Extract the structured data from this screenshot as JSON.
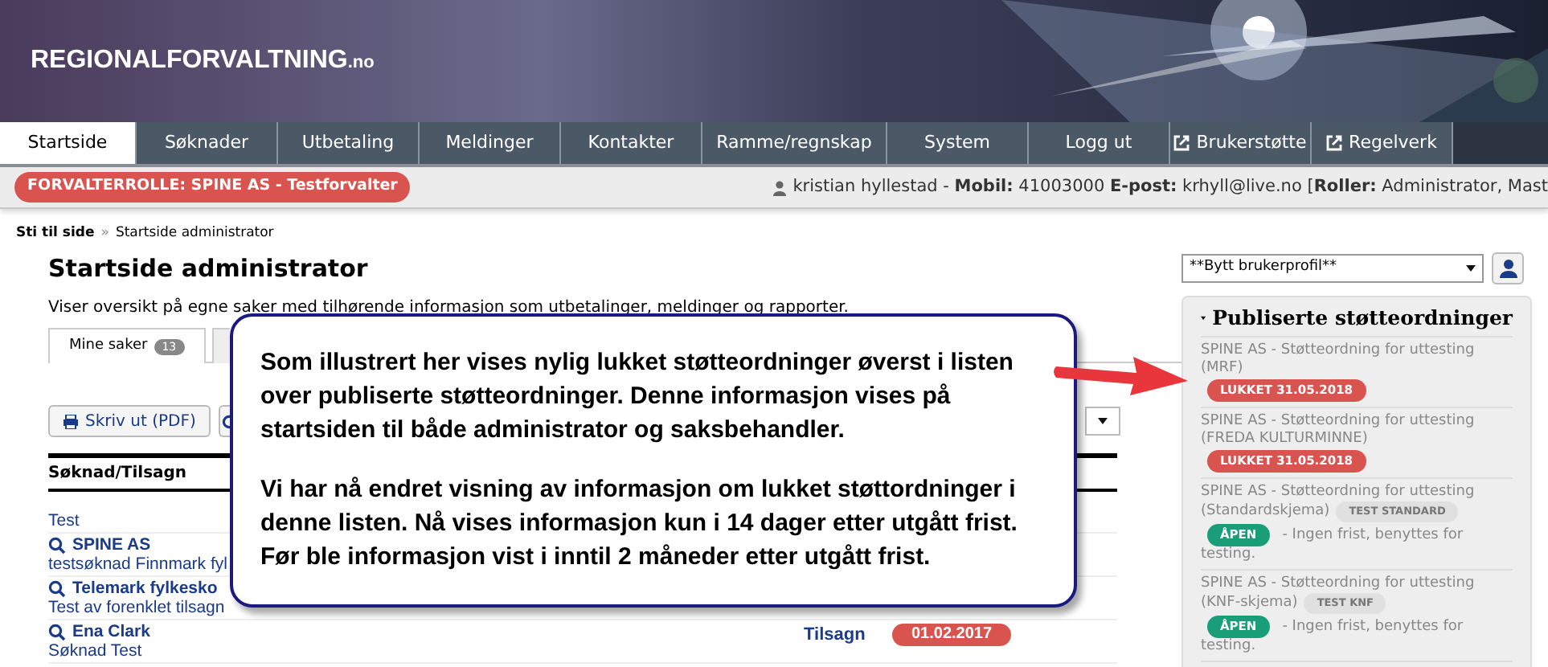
{
  "header": {
    "logo": "REGIONALFORVALTNING",
    "logo_suffix": ".no"
  },
  "nav": [
    {
      "label": "Startside",
      "selected": true,
      "external": false
    },
    {
      "label": "Søknader",
      "selected": false,
      "external": false
    },
    {
      "label": "Utbetaling",
      "selected": false,
      "external": false
    },
    {
      "label": "Meldinger",
      "selected": false,
      "external": false
    },
    {
      "label": "Kontakter",
      "selected": false,
      "external": false
    },
    {
      "label": "Ramme/regnskap",
      "selected": false,
      "external": false
    },
    {
      "label": "System",
      "selected": false,
      "external": false
    },
    {
      "label": "Logg ut",
      "selected": false,
      "external": false
    },
    {
      "label": "Brukerstøtte",
      "selected": false,
      "external": true
    },
    {
      "label": "Regelverk",
      "selected": false,
      "external": true
    }
  ],
  "role_badge": "FORVALTERROLLE: SPINE AS - Testforvalter",
  "user_info": "kristian hyllestad - **Mobil:** 41003000 **E-post:** krhyll@live.no [**Roller:** Administrator, Mast",
  "breadcrumb": {
    "root": "Sti til side",
    "separator": "»",
    "current": "Startside administrator"
  },
  "title": "Startside administrator",
  "description": "Viser oversikt på egne saker med tilhørende informasjon som utbetalinger, meldinger og rapporter.",
  "tabs": [
    {
      "label": "Mine saker",
      "count": "13",
      "selected": true
    }
  ],
  "print_button": "Skriv ut (PDF)",
  "table": {
    "column": "Søknad/Tilsagn",
    "rows": [
      {
        "title": "Test",
        "link": false
      },
      {
        "title": "SPINE AS",
        "subtitle": "testsøknad Finnmark fyl",
        "link": true
      },
      {
        "title": "Telemark fylkesko",
        "subtitle": "Test av forenklet tilsagn",
        "link": true
      },
      {
        "title": "Ena Clark",
        "subtitle": "Søknad Test",
        "link": true,
        "type": "Tilsagn",
        "date": "01.02.2017"
      }
    ]
  },
  "profile_select": {
    "value": "**Bytt brukerprofil**"
  },
  "published": {
    "title": "Publiserte støtteordninger",
    "expanded": true,
    "items": [
      {
        "name": "SPINE AS - Støtteordning for uttesting",
        "variant": "(MRF)",
        "status": "LUKKET 31.05.2018",
        "kind": "closed"
      },
      {
        "name": "SPINE AS - Støtteordning for uttesting",
        "variant": "(FREDA KULTURMINNE)",
        "status": "LUKKET 31.05.2018",
        "kind": "closed"
      },
      {
        "name": "SPINE AS - Støtteordning for uttesting",
        "variant": "(Standardskjema)",
        "tag": "TEST STANDARD",
        "status": "ÅPEN",
        "kind": "open",
        "note_lines": [
          "- Ingen frist, benyttes for",
          "testing."
        ]
      },
      {
        "name": "SPINE AS - Støtteordning for uttesting",
        "variant": "(KNF-skjema)",
        "tag": "TEST KNF",
        "status": "ÅPEN",
        "kind": "open",
        "note_lines": [
          "- Ingen frist, benyttes for",
          "testing."
        ]
      }
    ]
  },
  "callout": {
    "paragraphs": [
      "Som illustrert her vises nylig lukket støtteordninger øverst i listen over publiserte støtteordninger. Denne informasjon vises på startsiden til både administrator og saksbehandler.",
      "Vi har nå endret visning av informasjon om lukket støttordninger i denne listen. Nå vises informasjon kun i 14 dager etter utgått frist. Før ble informasjon vist i inntil 2 måneder etter utgått frist."
    ]
  }
}
